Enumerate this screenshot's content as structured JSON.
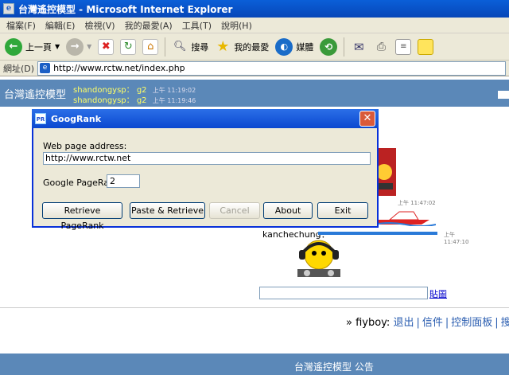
{
  "window": {
    "title": "台灣遙控模型 - Microsoft Internet Explorer"
  },
  "menu": {
    "items": [
      "檔案(F)",
      "編輯(E)",
      "檢視(V)",
      "我的最愛(A)",
      "工具(T)",
      "說明(H)"
    ]
  },
  "toolbar": {
    "back_label": "上一頁",
    "search_label": "搜尋",
    "favorites_label": "我的最愛",
    "media_label": "媒體"
  },
  "address": {
    "label": "網址(D)",
    "url": "http://www.rctw.net/index.php"
  },
  "site": {
    "banner": "台灣遙控模型",
    "chat": [
      {
        "user": "shandongysp：",
        "msg": "g2",
        "time": "上午 11:19:02"
      },
      {
        "user": "shandongysp：",
        "msg": "g2",
        "time": "上午 11:19:46"
      }
    ],
    "chat_user3": "kanchechung：",
    "time3": "上午 11:47:02",
    "time4": "上午 11:47:10",
    "post_link": "貼圖",
    "user_nav": {
      "prefix": "» fiyboy:",
      "logout": "退出",
      "mail": "信件",
      "control_panel": "控制面板",
      "search": "搜"
    },
    "footer_title": "台灣遙控模型 公告"
  },
  "dialog": {
    "title": "GoogRank",
    "icon_text": "PR",
    "address_label": "Web page address:",
    "address_value": "http://www.rctw.net",
    "pagerank_label": "Google PageRank:",
    "pagerank_value": "2",
    "buttons": {
      "retrieve": "Retrieve PageRank",
      "paste_retrieve": "Paste & Retrieve",
      "cancel": "Cancel",
      "about": "About",
      "exit": "Exit"
    }
  }
}
